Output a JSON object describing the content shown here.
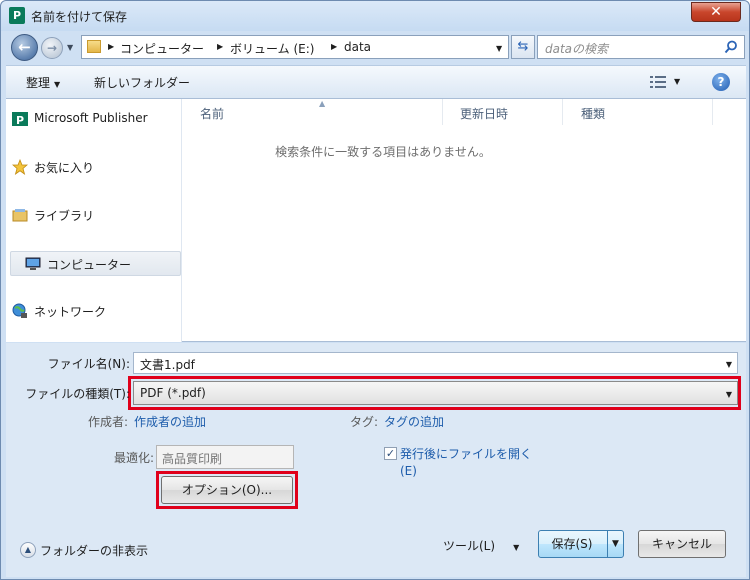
{
  "window": {
    "title": "名前を付けて保存",
    "app_icon": "P",
    "close": "✕"
  },
  "nav": {
    "back_glyph": "←",
    "forward_glyph": "→",
    "address_crumbs": [
      "コンピューター",
      "ボリューム (E:)",
      "data"
    ],
    "search_placeholder": "dataの検索"
  },
  "toolbar": {
    "organize_label": "整理",
    "new_folder_label": "新しいフォルダー",
    "help_glyph": "?"
  },
  "sidebar": {
    "items": [
      {
        "label": "Microsoft Publisher",
        "icon": "publisher-icon"
      },
      {
        "label": "お気に入り",
        "icon": "star-icon"
      },
      {
        "label": "ライブラリ",
        "icon": "library-icon"
      },
      {
        "label": "コンピューター",
        "icon": "computer-icon",
        "selected": true
      },
      {
        "label": "ネットワーク",
        "icon": "network-icon"
      }
    ]
  },
  "file_list": {
    "columns": [
      "名前",
      "更新日時",
      "種類"
    ],
    "empty_message": "検索条件に一致する項目はありません。"
  },
  "form": {
    "filename_label": "ファイル名(N):",
    "filename_value": "文書1.pdf",
    "filetype_label": "ファイルの種類(T):",
    "filetype_value": "PDF (*.pdf)",
    "author_label": "作成者:",
    "author_link": "作成者の追加",
    "tag_label": "タグ:",
    "tag_link": "タグの追加",
    "optimize_label": "最適化:",
    "optimize_value": "高品質印刷",
    "options_button": "オプション(O)...",
    "open_after_label_line1": "発行後にファイルを開く",
    "open_after_label_line2": "(E)",
    "open_after_checked": true
  },
  "footer": {
    "hide_folders": "フォルダーの非表示",
    "tools_label": "ツール(L)",
    "save_button": "保存(S)",
    "cancel_button": "キャンセル"
  },
  "colors": {
    "highlight_border": "#e0001b",
    "link": "#1d5cab",
    "chrome": "#dce8f5"
  }
}
